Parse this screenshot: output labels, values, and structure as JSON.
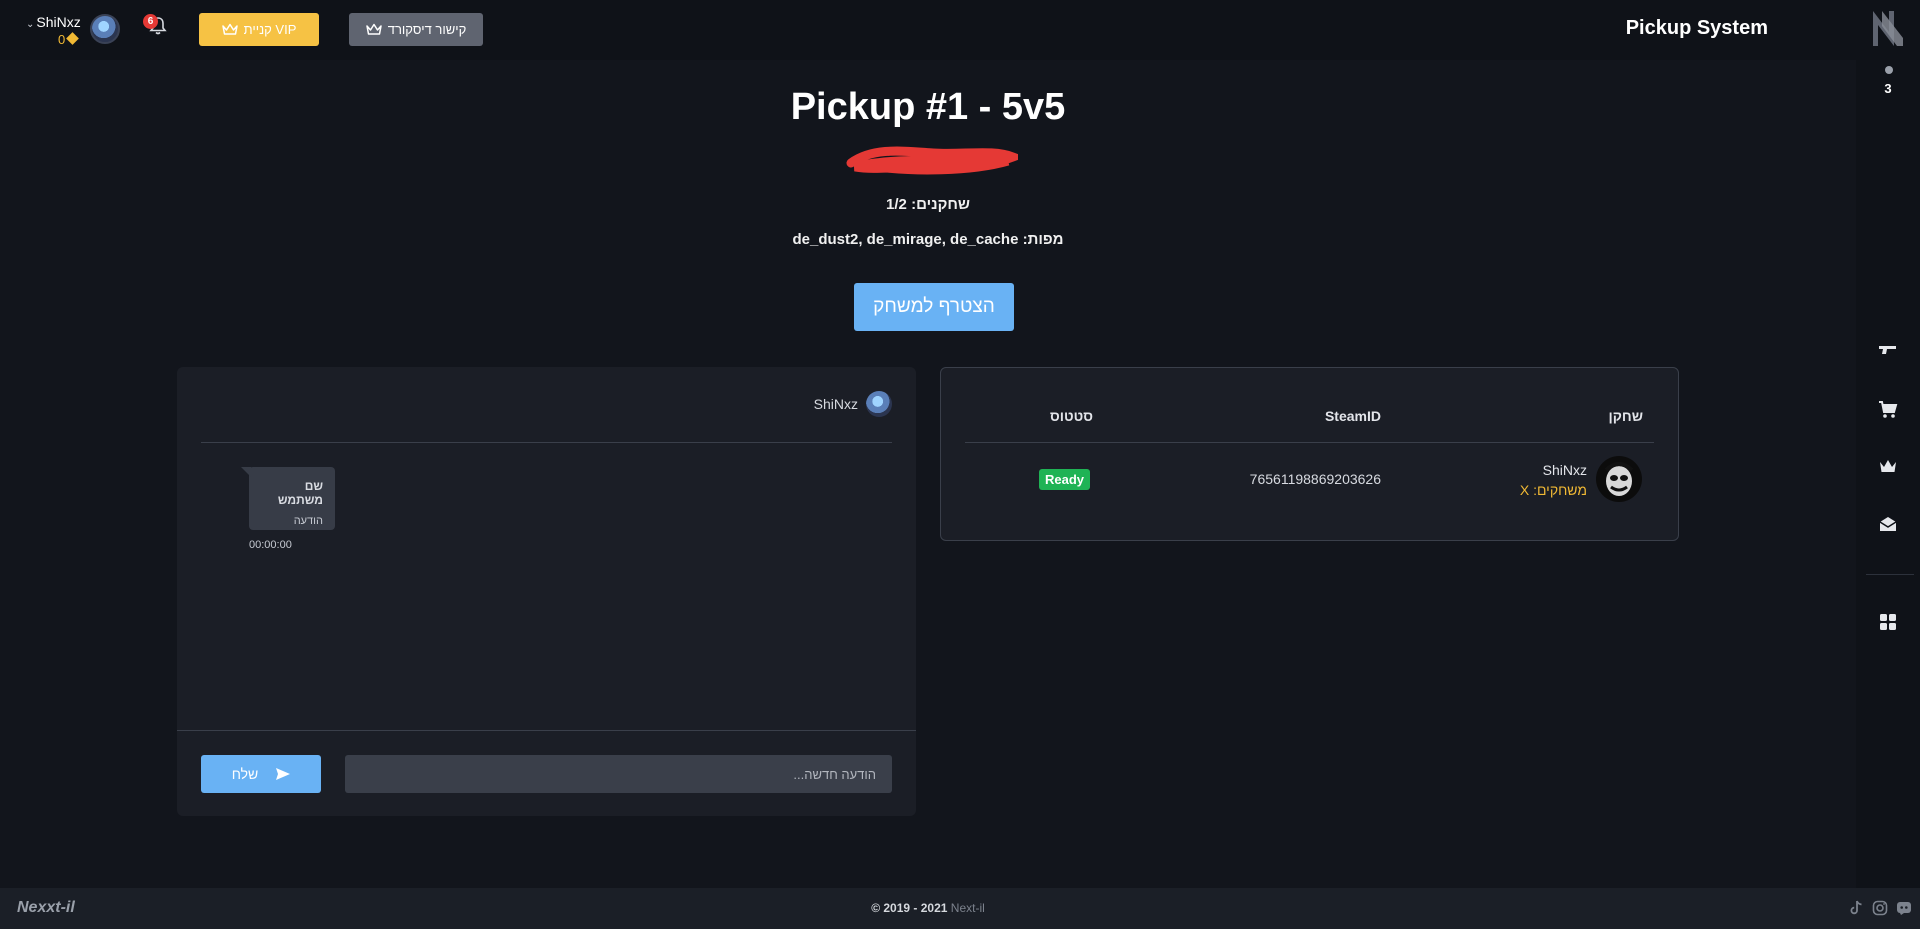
{
  "app": {
    "title": "Pickup System"
  },
  "user": {
    "name": "ShiNxz",
    "coins": "0",
    "notifications": "6"
  },
  "header_buttons": {
    "vip_label": "קניית VIP",
    "discord_label": "קישור דיסקורד"
  },
  "sidebar": {
    "count": "3"
  },
  "pickup": {
    "title": "Pickup #1 - 5v5",
    "players_line": "שחקנים: 1/2",
    "maps_line": "מפות: de_dust2, de_mirage, de_cache",
    "join_label": "הצטרף למשחק"
  },
  "chat": {
    "header_user": "ShiNxz",
    "message": {
      "name": "שם משתמש",
      "text": "הודעה",
      "time": "00:00:00"
    },
    "input_placeholder": "הודעה חדשה...",
    "send_label": "שלח"
  },
  "players_table": {
    "headers": {
      "player": "שחקן",
      "steamid": "SteamID",
      "status": "סטטוס"
    },
    "rows": [
      {
        "name": "ShiNxz",
        "games": "משחקים: X",
        "steamid": "76561198869203626",
        "status": "Ready"
      }
    ]
  },
  "footer": {
    "logo": "Nexxt-il",
    "copyright": "© 2019 - 2021",
    "brand": "Next-il"
  },
  "colors": {
    "background": "#12151c",
    "panel": "#1b1e26",
    "accent_blue": "#69b2f4",
    "vip_yellow": "#f6c244",
    "ready_green": "#1fb355",
    "redacted_red": "#e53935"
  },
  "icons": {
    "crown": "crown-icon",
    "bell": "bell-icon",
    "send": "send-icon",
    "gun": "gun-icon",
    "cart": "cart-icon",
    "envelope": "envelope-icon",
    "grid": "grid-icon"
  }
}
